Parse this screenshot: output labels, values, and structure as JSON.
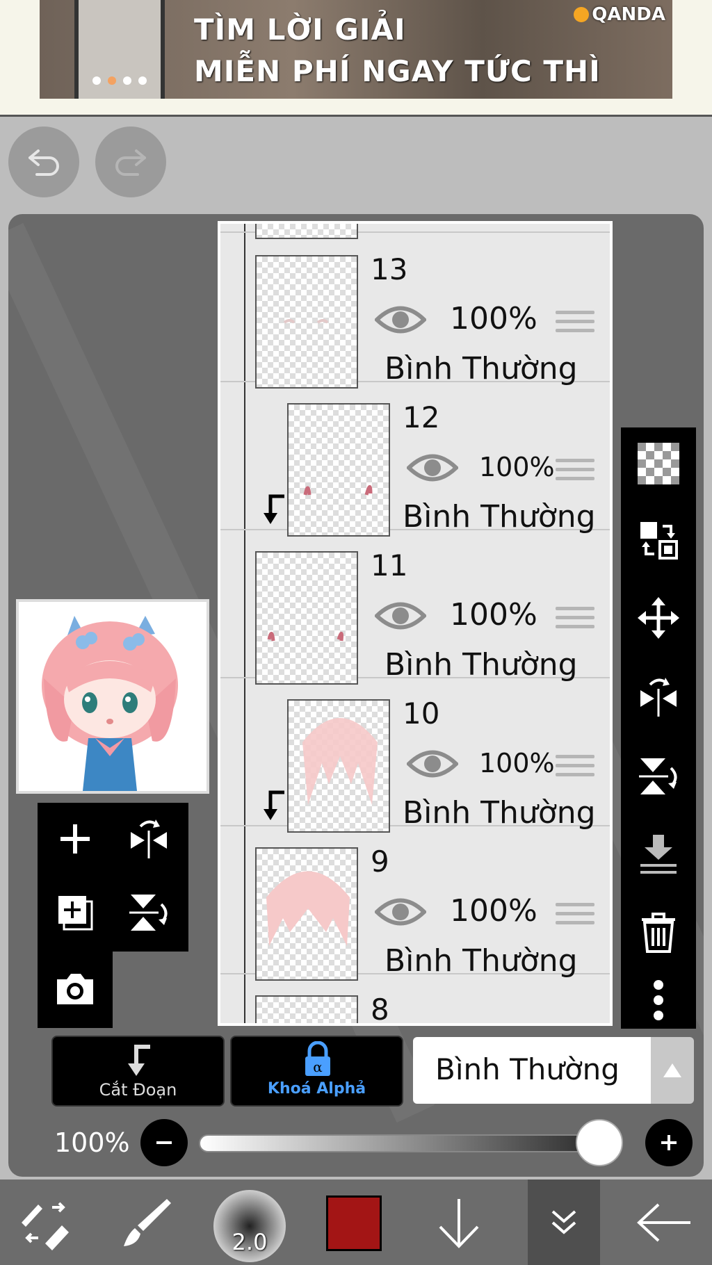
{
  "ad": {
    "line1": "TÌM LỜI GIẢI",
    "line2": "MIỄN PHÍ NGAY TỨC THÌ",
    "brand": "QANDA"
  },
  "layers": [
    {
      "number": "13",
      "opacity": "100%",
      "blend": "Bình Thường",
      "clipped": false
    },
    {
      "number": "12",
      "opacity": "100%",
      "blend": "Bình Thường",
      "clipped": true
    },
    {
      "number": "11",
      "opacity": "100%",
      "blend": "Bình Thường",
      "clipped": false
    },
    {
      "number": "10",
      "opacity": "100%",
      "blend": "Bình Thường",
      "clipped": true
    },
    {
      "number": "9",
      "opacity": "100%",
      "blend": "Bình Thường",
      "clipped": false
    },
    {
      "number": "8"
    }
  ],
  "controls": {
    "clip_label": "Cắt Đoạn",
    "alpha_lock_label": "Khoá Alphả",
    "blend_mode": "Bình Thường",
    "opacity_label": "100%",
    "opacity_value": 1.0
  },
  "toolbar": {
    "brush_size": "2.0",
    "color": "#a31515"
  },
  "colors": {
    "alpha_lock_accent": "#4a9fff",
    "panel_bg": "#6a6a6a",
    "toolbar_bg": "#000000"
  }
}
